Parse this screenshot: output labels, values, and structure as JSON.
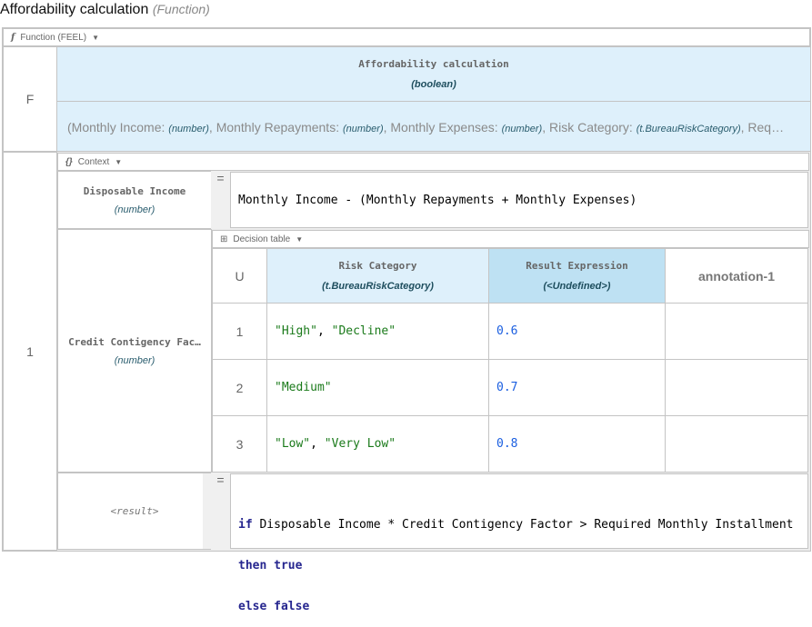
{
  "title": {
    "name": "Affordability calculation",
    "kind": "(Function)"
  },
  "function_bar": {
    "icon": "f",
    "label": "Function (FEEL)"
  },
  "function_row": {
    "row_label": "F",
    "header_name": "Affordability calculation",
    "header_type": "(boolean)",
    "params": [
      {
        "name": "Monthly Income",
        "type": "(number)"
      },
      {
        "name": "Monthly Repayments",
        "type": "(number)"
      },
      {
        "name": "Monthly Expenses",
        "type": "(number)"
      },
      {
        "name": "Risk Category",
        "type": "(t.BureauRiskCategory)"
      }
    ],
    "params_overflow": "Req…"
  },
  "body_row": {
    "row_label": "1"
  },
  "context": {
    "bar_icon": "{}",
    "bar_label": "Context",
    "entries": [
      {
        "name": "Disposable Income",
        "type": "(number)",
        "eq": "=",
        "expression": "Monthly Income - (Monthly Repayments + Monthly Expenses)"
      },
      {
        "name": "Credit Contigency Fac…",
        "type": "(number)"
      }
    ],
    "result": {
      "name": "<result>",
      "eq": "=",
      "lines": [
        {
          "kw": "if",
          "text": " Disposable Income * Credit Contigency Factor > Required Monthly Installment"
        },
        {
          "kw": "then true",
          "text": ""
        },
        {
          "kw": "else false",
          "text": ""
        }
      ]
    }
  },
  "decision_table": {
    "bar_label": "Decision table",
    "hit_policy": "U",
    "input_header": {
      "name": "Risk Category",
      "type": "(t.BureauRiskCategory)"
    },
    "output_header": {
      "name": "Result Expression",
      "type": "(<Undefined>)"
    },
    "annotation_header": "annotation-1",
    "rows": [
      {
        "index": "1",
        "input": [
          [
            "\"High\"",
            ", "
          ],
          [
            "\"Decline\"",
            ""
          ]
        ],
        "output": "0.6",
        "annotation": ""
      },
      {
        "index": "2",
        "input": [
          [
            "\"Medium\"",
            ""
          ]
        ],
        "output": "0.7",
        "annotation": ""
      },
      {
        "index": "3",
        "input": [
          [
            "\"Low\"",
            ", "
          ],
          [
            "\"Very Low\"",
            ""
          ]
        ],
        "output": "0.8",
        "annotation": ""
      }
    ]
  },
  "colors": {
    "header_blue": "#def0fb",
    "output_header_blue": "#bee1f3",
    "string": "#1a7a1a",
    "number": "#1a5ee0",
    "keyword": "#26268f"
  }
}
